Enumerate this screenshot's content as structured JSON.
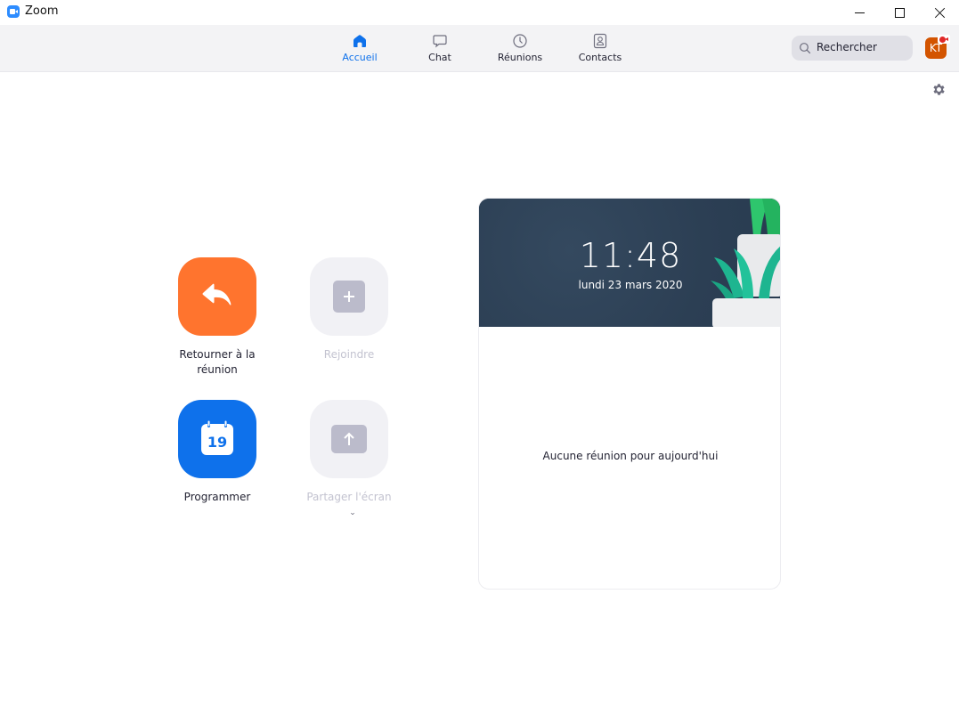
{
  "window": {
    "title": "Zoom",
    "app_icon": "zoom-camera-icon",
    "controls": {
      "minimize": "minimize-icon",
      "maximize": "maximize-icon",
      "close": "close-icon"
    }
  },
  "nav": {
    "tabs": [
      {
        "label": "Accueil",
        "icon": "home-icon",
        "active": true
      },
      {
        "label": "Chat",
        "icon": "chat-bubble-icon",
        "active": false
      },
      {
        "label": "Réunions",
        "icon": "clock-icon",
        "active": false
      },
      {
        "label": "Contacts",
        "icon": "contact-card-icon",
        "active": false
      }
    ],
    "search": {
      "placeholder": "Rechercher",
      "icon": "search-icon"
    },
    "avatar": {
      "initials": "KT",
      "badge": "recording-camera-icon",
      "color": "#D35400"
    },
    "settings_icon": "gear-icon",
    "accent": "#0E71EB"
  },
  "actions": [
    {
      "label": "Retourner à la réunion",
      "icon": "return-arrow-icon",
      "color": "#FF742E",
      "enabled": true
    },
    {
      "label": "Rejoindre",
      "icon": "plus-icon",
      "enabled": false
    },
    {
      "label": "Programmer",
      "icon": "calendar-icon",
      "calendar_day": "19",
      "color": "#0E71EB",
      "enabled": true
    },
    {
      "label": "Partager l'écran",
      "icon": "share-up-arrow-icon",
      "enabled": false,
      "has_dropdown": true
    }
  ],
  "card": {
    "time": "11:48",
    "date": "lundi 23 mars 2020",
    "empty_message": "Aucune réunion pour aujourd'hui"
  }
}
